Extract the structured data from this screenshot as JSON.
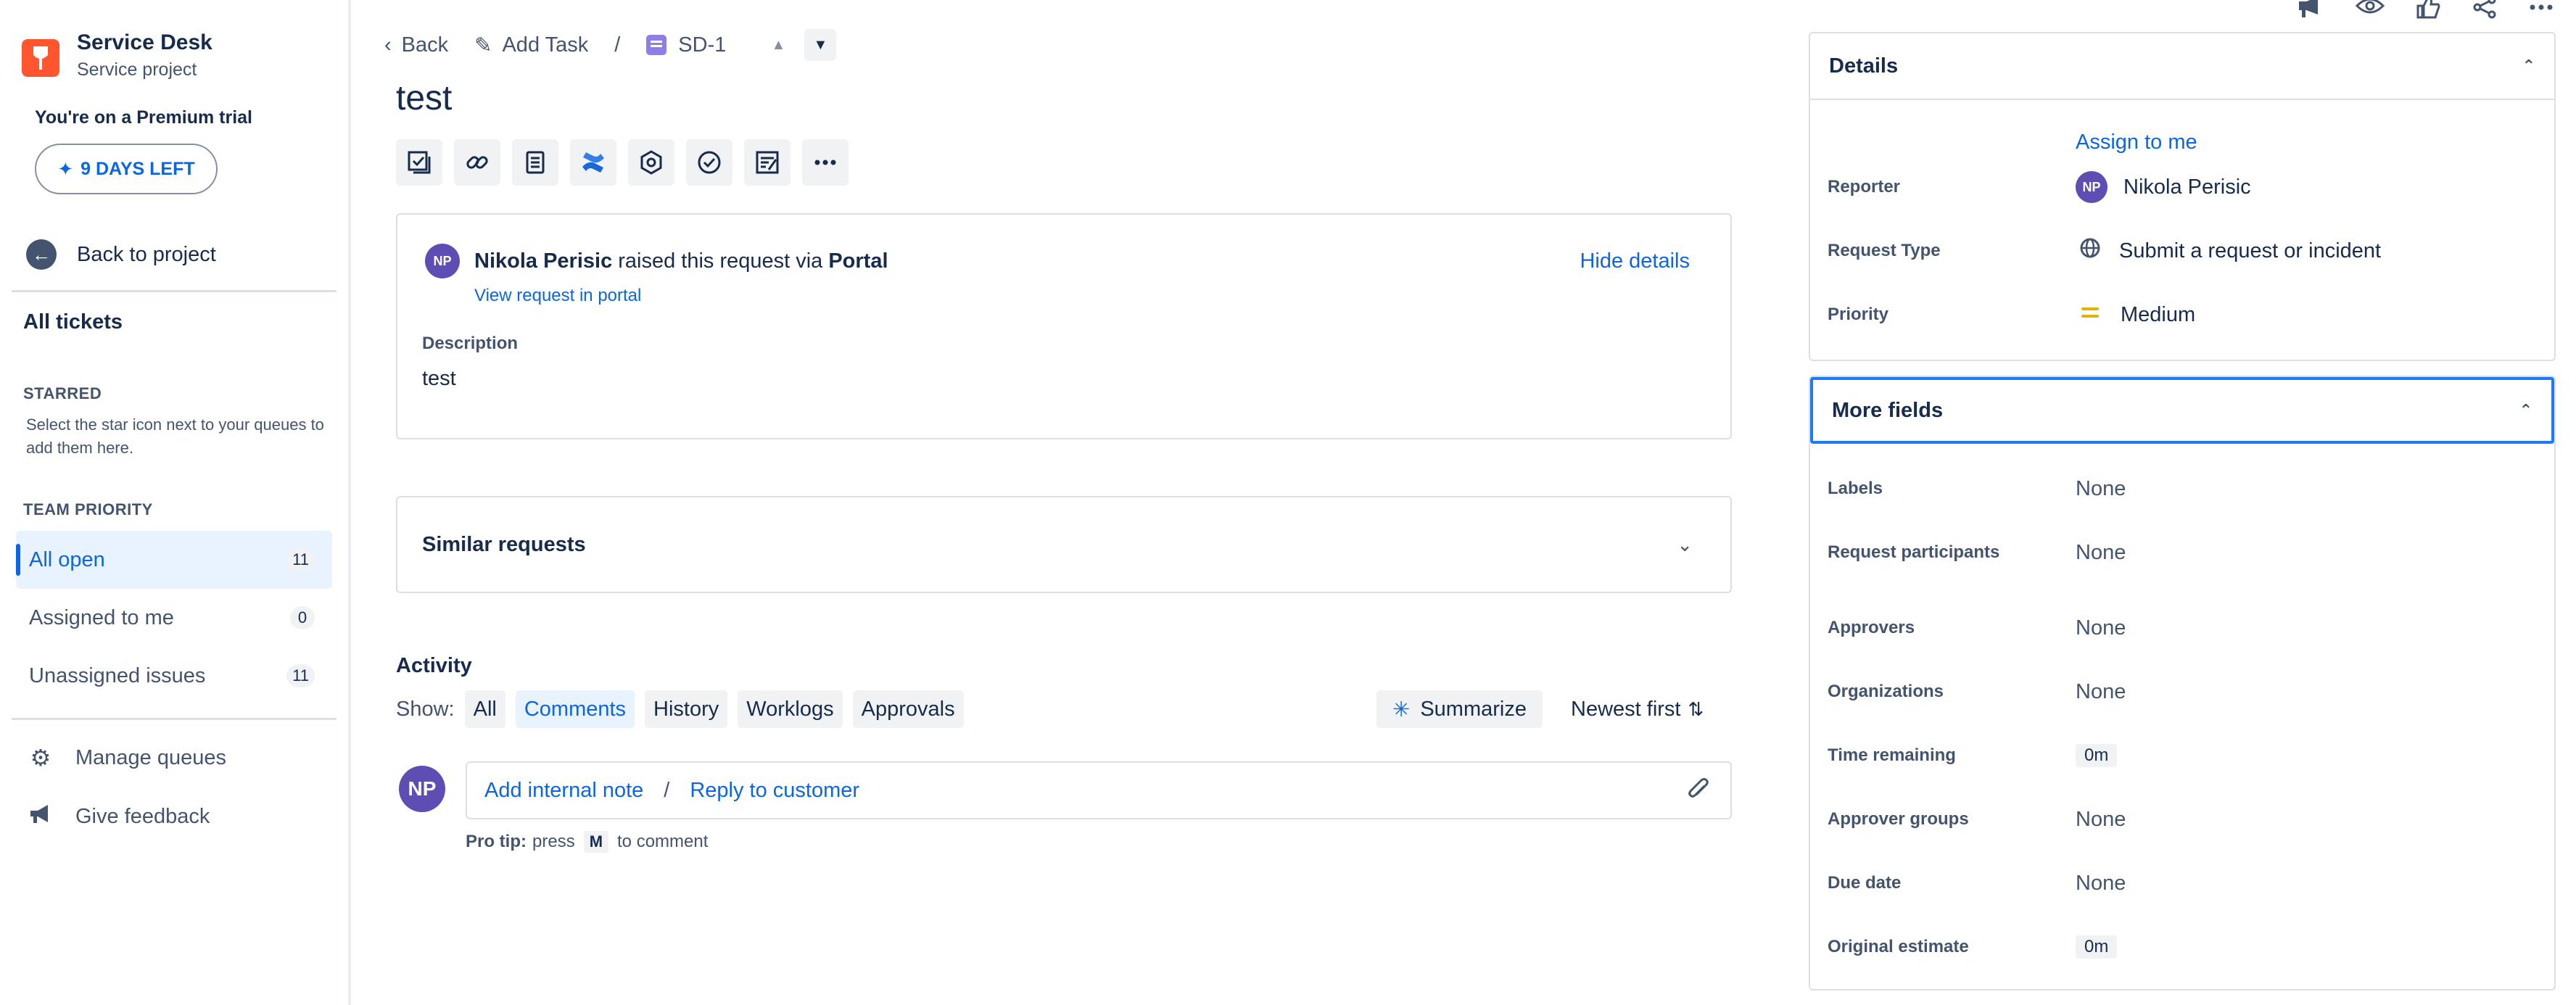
{
  "sidebar": {
    "project_name": "Service Desk",
    "project_type": "Service project",
    "trial_text": "You're on a Premium trial",
    "trial_button": "9 DAYS LEFT",
    "back_to_project": "Back to project",
    "all_tickets": "All tickets",
    "starred_heading": "STARRED",
    "starred_hint": "Select the star icon next to your queues to add them here.",
    "team_priority_heading": "TEAM PRIORITY",
    "queues": [
      {
        "label": "All open",
        "count": "11"
      },
      {
        "label": "Assigned to me",
        "count": "0"
      },
      {
        "label": "Unassigned issues",
        "count": "11"
      }
    ],
    "manage_queues": "Manage queues",
    "give_feedback": "Give feedback"
  },
  "topnav": {
    "back": "Back",
    "add_task": "Add Task",
    "separator": "/",
    "issue_key": "SD-1"
  },
  "issue": {
    "title": "test",
    "toolbar_icons": [
      "checklist-icon",
      "link-icon",
      "document-icon",
      "confluence-icon",
      "settings-hex-icon",
      "check-circle-icon",
      "form-icon",
      "more-icon"
    ]
  },
  "request": {
    "avatar_initials": "NP",
    "reporter_name": "Nikola Perisic",
    "raised_text": "raised this request via",
    "channel": "Portal",
    "view_portal": "View request in portal",
    "hide_details": "Hide details",
    "description_label": "Description",
    "description_value": "test"
  },
  "similar": {
    "label": "Similar requests"
  },
  "activity": {
    "heading": "Activity",
    "show_label": "Show:",
    "filters": [
      "All",
      "Comments",
      "History",
      "Worklogs",
      "Approvals"
    ],
    "selected_filter": "Comments",
    "summarize": "Summarize",
    "sort": "Newest first",
    "commenter_initials": "NP",
    "add_internal_note": "Add internal note",
    "slash": "/",
    "reply_to_customer": "Reply to customer",
    "protip_label": "Pro tip:",
    "protip_press": "press",
    "protip_key": "M",
    "protip_end": "to comment"
  },
  "details": {
    "heading": "Details",
    "assign_to_me": "Assign to me",
    "reporter_label": "Reporter",
    "reporter_initials": "NP",
    "reporter_value": "Nikola Perisic",
    "request_type_label": "Request Type",
    "request_type_value": "Submit a request or incident",
    "priority_label": "Priority",
    "priority_value": "Medium",
    "priority_color": "#e2b203"
  },
  "more_fields": {
    "heading": "More fields",
    "fields": [
      {
        "label": "Labels",
        "value": "None"
      },
      {
        "label": "Request participants",
        "value": "None"
      },
      {
        "label": "Approvers",
        "value": "None"
      },
      {
        "label": "Organizations",
        "value": "None"
      },
      {
        "label": "Time remaining",
        "value": "0m"
      },
      {
        "label": "Approver groups",
        "value": "None"
      },
      {
        "label": "Due date",
        "value": "None"
      },
      {
        "label": "Original estimate",
        "value": "0m"
      }
    ]
  },
  "colors": {
    "accent": "#0c66e4",
    "brand": "#ff5630",
    "avatar": "#5e4db2"
  }
}
